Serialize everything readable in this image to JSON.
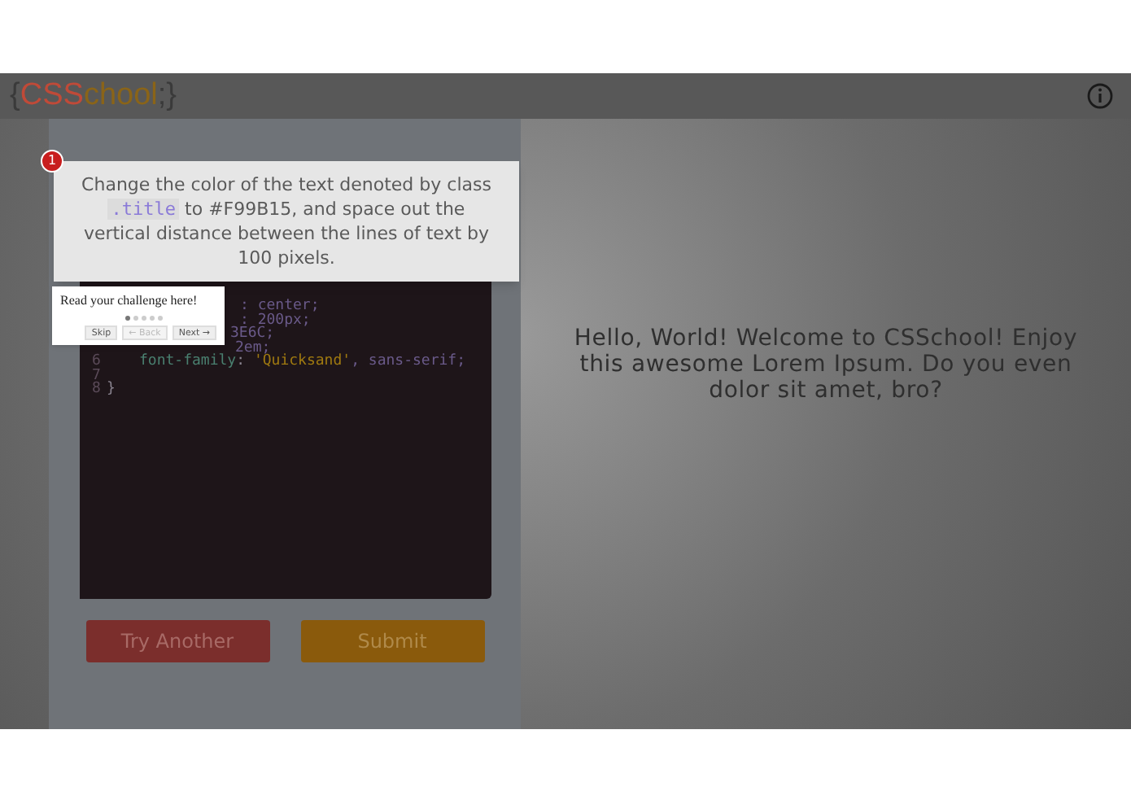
{
  "header": {
    "logo": [
      {
        "text": "{",
        "color": "#3a3a3a"
      },
      {
        "text": "CSS",
        "color": "#c04a38"
      },
      {
        "text": "chool",
        "color": "#8a6418"
      },
      {
        "text": ";}",
        "color": "#3a3a3a"
      }
    ]
  },
  "challenge": {
    "step": "1",
    "text_before": "Change the color of the text denoted by class",
    "code": ".title",
    "text_after": "to #F99B15, and space out the vertical distance between the lines of text by 100 pixels."
  },
  "tour": {
    "message": "Read your challenge here!",
    "dots": [
      {
        "selected": true
      },
      {
        "selected": false
      },
      {
        "selected": false
      },
      {
        "selected": false
      },
      {
        "selected": false
      }
    ],
    "buttons": [
      {
        "label": "Skip",
        "disabled": false
      },
      {
        "label": "← Back",
        "disabled": true
      },
      {
        "label": "Next →",
        "disabled": false
      }
    ]
  },
  "editor": {
    "lines": [
      {
        "kind": "fragment",
        "parts": [
          {
            "text": ": center;",
            "kind": "value"
          }
        ]
      },
      {
        "kind": "fragment",
        "parts": [
          {
            "text": ": 200px;",
            "kind": "value"
          }
        ]
      },
      {
        "kind": "fragment",
        "parts": [
          {
            "text": "3E6C;",
            "kind": "value"
          }
        ]
      },
      {
        "kind": "fragment",
        "parts": [
          {
            "text": "2em;",
            "kind": "value"
          }
        ]
      },
      {
        "kind": "full",
        "number": "6",
        "parts": [
          {
            "text": "font-family",
            "kind": "property"
          },
          {
            "text": ": ",
            "kind": "plain"
          },
          {
            "text": "'Quicksand'",
            "kind": "string"
          },
          {
            "text": ", sans-serif;",
            "kind": "value"
          }
        ]
      },
      {
        "kind": "full",
        "number": "7"
      },
      {
        "kind": "full",
        "number": "8",
        "parts": [
          {
            "text": "}",
            "kind": "plain"
          }
        ]
      }
    ]
  },
  "buttons": [
    {
      "label": "Try Another",
      "kind": "danger"
    },
    {
      "label": "Submit",
      "kind": "warning"
    }
  ],
  "preview": {
    "text": "Hello, World! Welcome to CSSchool! Enjoy this awesome Lorem Ipsum. Do you even dolor sit amet, bro?"
  }
}
